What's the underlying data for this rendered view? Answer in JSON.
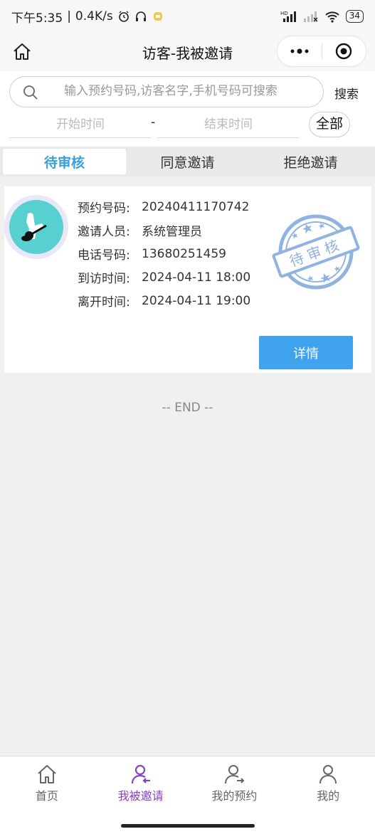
{
  "status_bar": {
    "time": "下午5:35",
    "speed": "0.4K/s",
    "network": "HD",
    "battery": "34"
  },
  "nav": {
    "title": "访客-我被邀请"
  },
  "search": {
    "placeholder": "输入预约号码,访客名字,手机号码可搜索",
    "button_label": "搜索",
    "start_placeholder": "开始时间",
    "separator": "-",
    "end_placeholder": "结束时间",
    "all_label": "全部"
  },
  "tabs": [
    {
      "label": "待审核",
      "active": true
    },
    {
      "label": "同意邀请",
      "active": false
    },
    {
      "label": "拒绝邀请",
      "active": false
    }
  ],
  "card": {
    "rows": [
      {
        "label": "预约号码:",
        "value": "20240411170742"
      },
      {
        "label": "邀请人员:",
        "value": "系统管理员"
      },
      {
        "label": "电话号码:",
        "value": "13680251459"
      },
      {
        "label": "到访时间:",
        "value": "2024-04-11 18:00"
      },
      {
        "label": "离开时间:",
        "value": "2024-04-11 19:00"
      }
    ],
    "stamp_text": "待审核",
    "detail_label": "详情"
  },
  "end_text": "-- END --",
  "tabbar": [
    {
      "label": "首页",
      "icon": "home-icon",
      "active": false
    },
    {
      "label": "我被邀请",
      "icon": "user-invited-icon",
      "active": true
    },
    {
      "label": "我的预约",
      "icon": "user-appointment-icon",
      "active": false
    },
    {
      "label": "我的",
      "icon": "user-icon",
      "active": false
    }
  ],
  "colors": {
    "accent_tab": "#3a9ed8",
    "detail_button": "#3fa3ed",
    "tabbar_active": "#8a3fc4",
    "stamp": "#7ea6dc"
  }
}
